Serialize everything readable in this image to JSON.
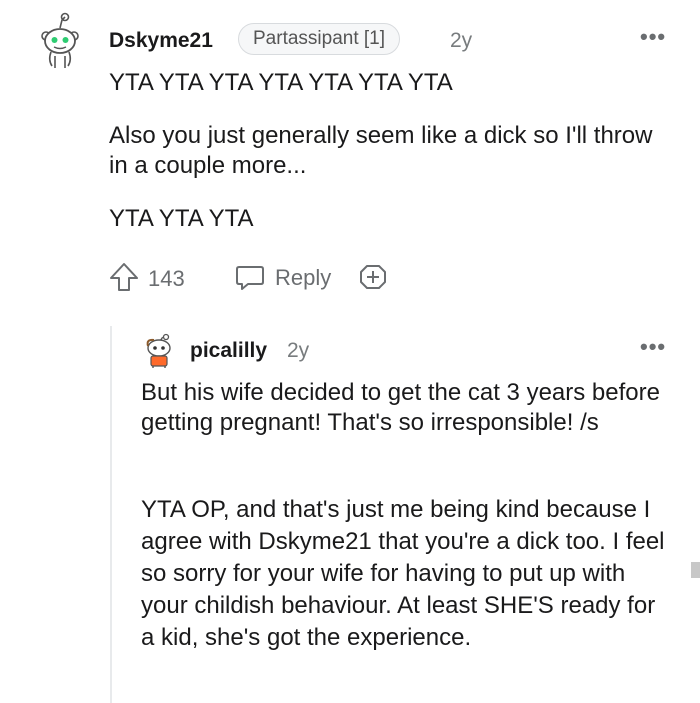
{
  "comment": {
    "author": "Dskyme21",
    "flair": "Partassipant [1]",
    "age": "2y",
    "paragraphs": [
      "YTA YTA YTA YTA YTA YTA YTA",
      "Also you just generally seem like a dick so I'll throw in a couple more...",
      "YTA YTA YTA"
    ],
    "upvotes": "143",
    "reply_label": "Reply"
  },
  "reply": {
    "author": "picalilly",
    "age": "2y",
    "paragraphs": [
      "But his wife decided to get the cat 3 years before getting pregnant! That's so irresponsible! /s",
      "YTA OP, and that's just me being kind because I agree with Dskyme21 that you're a dick too. I feel so sorry for your wife for having to put up with your childish behaviour. At least SHE'S ready for a kid, she's got the experience."
    ]
  },
  "icons": {
    "more": "more-options-icon",
    "upvote": "upvote-arrow-icon",
    "reply": "speech-bubble-icon",
    "award": "add-award-icon"
  },
  "colors": {
    "avatar_accent": "#2ecc71",
    "avatar2_accent": "#ff6a2b",
    "muted": "#787c7e"
  }
}
